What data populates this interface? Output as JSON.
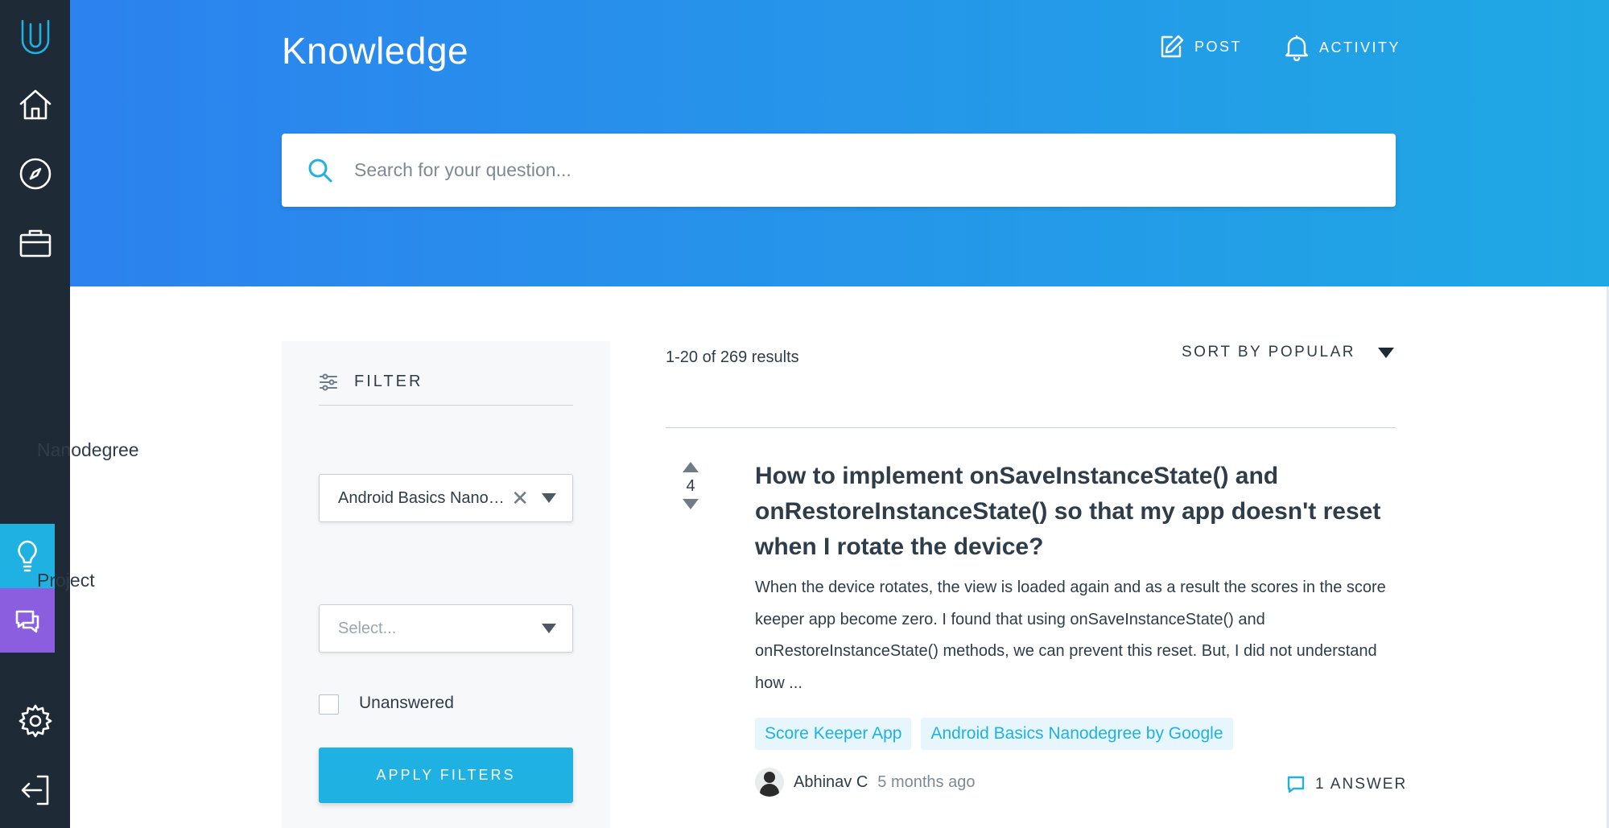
{
  "rail": {
    "items": [
      {
        "name": "udacity-logo-icon"
      },
      {
        "name": "home-icon"
      },
      {
        "name": "compass-icon"
      },
      {
        "name": "briefcase-icon"
      },
      {
        "name": "lightbulb-icon",
        "active": true,
        "color": "#1fb1e2"
      },
      {
        "name": "chat-icon",
        "color": "#8b5ee0"
      },
      {
        "name": "gear-icon"
      },
      {
        "name": "logout-icon"
      }
    ],
    "background": "#1f2a37"
  },
  "header": {
    "title": "Knowledge",
    "post_label": "POST",
    "post_icon": "edit-icon",
    "activity_label": "ACTIVITY",
    "activity_icon": "bell-icon",
    "gradient": [
      "#2c82ef",
      "#1fa8e4"
    ]
  },
  "search": {
    "placeholder": "Search for your question...",
    "value": "",
    "icon": "search-icon"
  },
  "filter": {
    "heading": "FILTER",
    "nanodegree_label": "Nanodegree",
    "nanodegree_value": "Android Basics Nanodegree by Google",
    "project_label": "Project",
    "project_placeholder": "Select...",
    "unanswered_label": "Unanswered",
    "unanswered_checked": false,
    "apply_label": "APPLY FILTERS",
    "accent": "#1fb1e2"
  },
  "results": {
    "count_text": "1-20 of 269 results",
    "sort_label": "SORT BY POPULAR"
  },
  "question": {
    "votes": "4",
    "title": "How to implement onSaveInstanceState() and onRestoreInstanceState() so that my app doesn't reset when I rotate the device?",
    "excerpt": "When the device rotates, the view is loaded again and as a result the scores in the score keeper app become zero. I found that using onSaveInstanceState() and onRestoreInstanceState() methods, we can prevent this reset. But, I did not understand how ...",
    "tags": [
      "Score Keeper App",
      "Android Basics Nanodegree by Google"
    ],
    "author": "Abhinav C",
    "time": "5 months ago",
    "answers_label": "1 ANSWER"
  }
}
